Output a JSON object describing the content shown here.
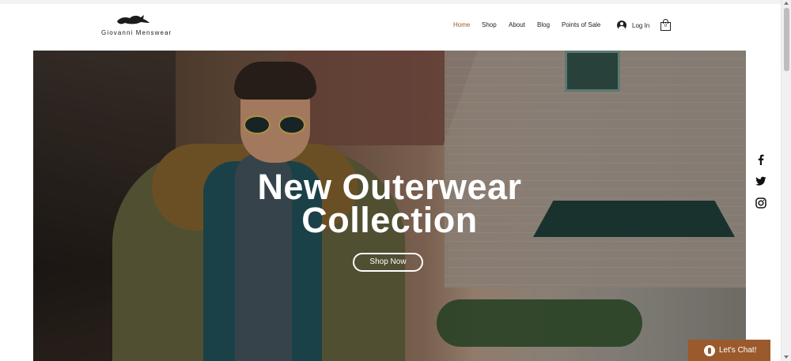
{
  "header": {
    "brand": "Giovanni Menswear",
    "nav": [
      {
        "label": "Home",
        "active": true
      },
      {
        "label": "Shop",
        "active": false
      },
      {
        "label": "About",
        "active": false
      },
      {
        "label": "Blog",
        "active": false
      },
      {
        "label": "Points of Sale",
        "active": false
      }
    ],
    "login_label": "Log In",
    "cart_count": "0"
  },
  "hero": {
    "title_line1": "New Outerwear",
    "title_line2": "Collection",
    "button_label": "Shop Now"
  },
  "social": [
    "facebook-icon",
    "twitter-icon",
    "instagram-icon"
  ],
  "chat": {
    "label": "Let's Chat!"
  },
  "colors": {
    "accent": "#9a5a2c",
    "active_nav": "#a05a2c",
    "text": "#222222",
    "hero_text": "#ffffff"
  }
}
